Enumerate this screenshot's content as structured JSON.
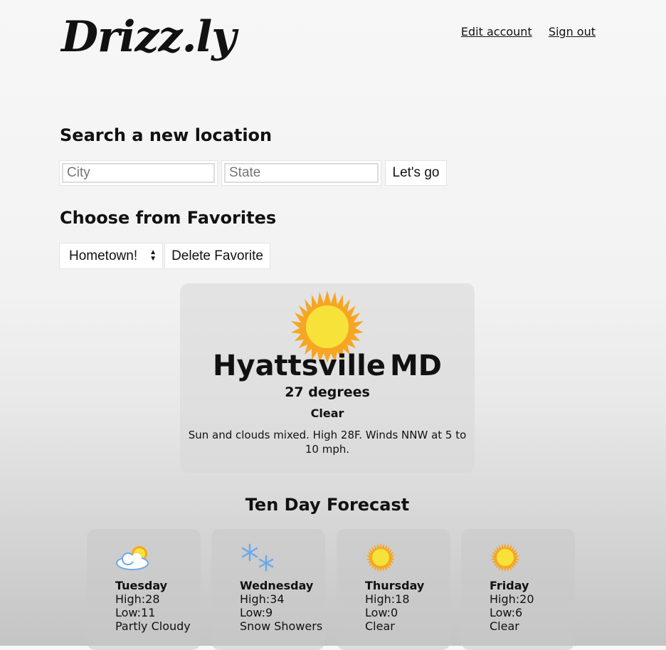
{
  "app": {
    "logo": "Drizz.ly"
  },
  "header": {
    "edit_account": "Edit account",
    "sign_out": "Sign out"
  },
  "search": {
    "heading": "Search a new location",
    "city_placeholder": "City",
    "state_placeholder": "State",
    "submit_label": "Let's go"
  },
  "favorites": {
    "heading": "Choose from Favorites",
    "selected": "Hometown!",
    "delete_label": "Delete Favorite"
  },
  "current": {
    "icon": "sun-icon",
    "city": "Hyattsville",
    "state": "MD",
    "temperature": "27 degrees",
    "condition": "Clear",
    "description": "Sun and clouds mixed. High 28F. Winds NNW at 5 to 10 mph."
  },
  "forecast": {
    "title": "Ten Day Forecast",
    "days": [
      {
        "icon": "partly-cloudy-icon",
        "day": "Tuesday",
        "high": "High:28",
        "low": "Low:11",
        "condition": "Partly Cloudy"
      },
      {
        "icon": "snowflake-icon",
        "day": "Wednesday",
        "high": "High:34",
        "low": "Low:9",
        "condition": "Snow Showers"
      },
      {
        "icon": "sun-icon",
        "day": "Thursday",
        "high": "High:18",
        "low": "Low:0",
        "condition": "Clear"
      },
      {
        "icon": "sun-icon",
        "day": "Friday",
        "high": "High:20",
        "low": "Low:6",
        "condition": "Clear"
      }
    ]
  },
  "colors": {
    "sun_outer": "#f6a623",
    "sun_inner": "#f7e23a",
    "snow": "#6aa9e8"
  }
}
